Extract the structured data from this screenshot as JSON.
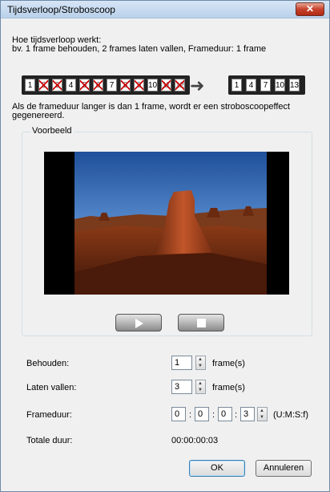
{
  "window": {
    "title": "Tijdsverloop/Stroboscoop",
    "close_label": "✕"
  },
  "description": {
    "line1": "Hoe tijdsverloop werkt:",
    "line2": "bv. 1 frame behouden, 2 frames laten vallen, Frameduur: 1 frame"
  },
  "frames_before": [
    {
      "n": "1",
      "dropped": false
    },
    {
      "n": "2",
      "dropped": true
    },
    {
      "n": "3",
      "dropped": true
    },
    {
      "n": "4",
      "dropped": false
    },
    {
      "n": "5",
      "dropped": true
    },
    {
      "n": "6",
      "dropped": true
    },
    {
      "n": "7",
      "dropped": false
    },
    {
      "n": "8",
      "dropped": true
    },
    {
      "n": "9",
      "dropped": true
    },
    {
      "n": "10",
      "dropped": false
    },
    {
      "n": "11",
      "dropped": true
    },
    {
      "n": "12",
      "dropped": true
    }
  ],
  "frames_after": [
    "1",
    "4",
    "7",
    "10",
    "13"
  ],
  "note": "Als de frameduur langer is dan 1 frame, wordt er een stroboscoopeffect gegenereerd.",
  "preview": {
    "group_label": "Voorbeeld",
    "play_icon": "play-icon",
    "stop_icon": "stop-icon"
  },
  "form": {
    "keep_label": "Behouden:",
    "keep_value": "1",
    "keep_unit": "frame(s)",
    "drop_label": "Laten vallen:",
    "drop_value": "3",
    "drop_unit": "frame(s)",
    "duration_label": "Frameduur:",
    "duration_h": "0",
    "duration_m": "0",
    "duration_s": "0",
    "duration_f": "3",
    "duration_sep": ":",
    "duration_unit": "(U:M:S:f)",
    "total_label": "Totale duur:",
    "total_value": "00:00:00:03"
  },
  "buttons": {
    "ok": "OK",
    "cancel": "Annuleren"
  },
  "colors": {
    "close": "#c7422c",
    "strip": "#222222",
    "drop_mark": "#cc0000"
  }
}
